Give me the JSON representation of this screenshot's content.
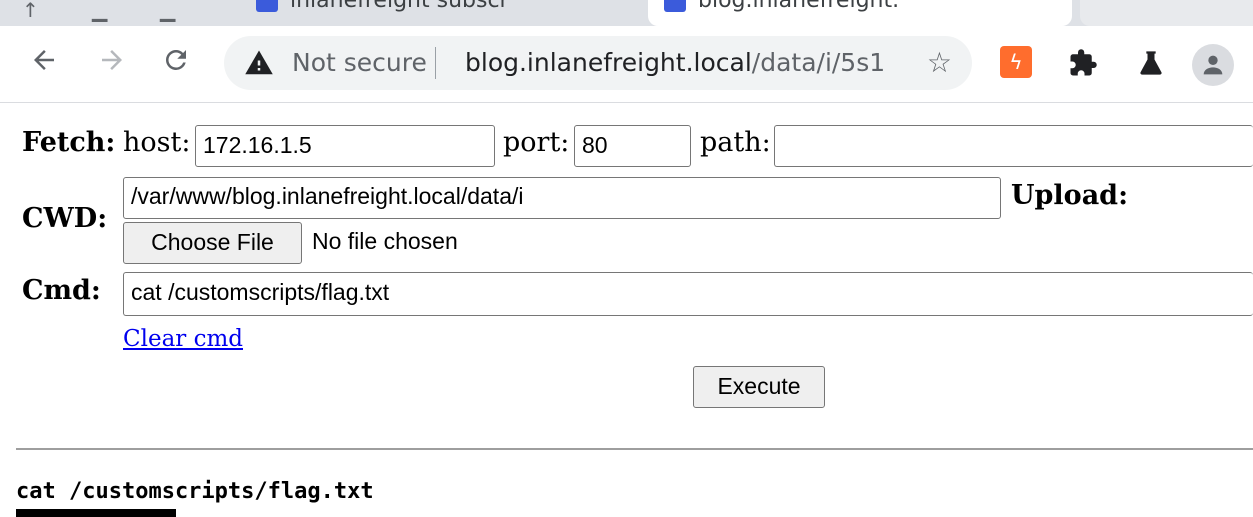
{
  "browser": {
    "tabs": [
      {
        "title": "inlanefreight subscr",
        "active": false
      },
      {
        "title": "blog.inlanefreight.",
        "active": true
      }
    ],
    "address": {
      "security_label": "Not secure",
      "host": "blog.inlanefreight.local",
      "path": "/data/i/5s1"
    },
    "colors": {
      "tab_strip": "#dee1e6",
      "omnibox": "#f1f3f4",
      "extension_orange": "#ff6d2d",
      "link": "#0000ee"
    },
    "icons": [
      "back-arrow-icon",
      "forward-arrow-icon",
      "reload-icon",
      "warning-icon",
      "star-icon",
      "extension-icon",
      "puzzle-icon",
      "flask-icon",
      "profile-icon"
    ]
  },
  "shell": {
    "fetch": {
      "label": "Fetch:",
      "host_label": "host:",
      "host_value": "172.16.1.5",
      "port_label": "port:",
      "port_value": "80",
      "path_label": "path:",
      "path_value": ""
    },
    "cwd": {
      "label": "CWD:",
      "value": "/var/www/blog.inlanefreight.local/data/i",
      "upload_label": "Upload:",
      "choose_file_label": "Choose File",
      "file_status": "No file chosen"
    },
    "cmd": {
      "label": "Cmd:",
      "value": "cat /customscripts/flag.txt",
      "clear_label": "Clear cmd",
      "execute_label": "Execute"
    },
    "output": {
      "command_echo": "cat /customscripts/flag.txt"
    }
  }
}
